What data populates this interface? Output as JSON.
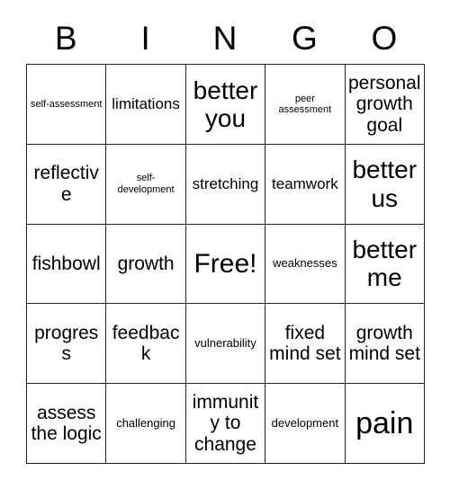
{
  "card": {
    "header_letters": [
      "B",
      "I",
      "N",
      "G",
      "O"
    ],
    "grid_rows": [
      [
        {
          "text": "self-assessment",
          "size": "sz-xs"
        },
        {
          "text": "limitations",
          "size": "sz-m"
        },
        {
          "text": "better you",
          "size": "sz-xl"
        },
        {
          "text": "peer assessment",
          "size": "sz-xs"
        },
        {
          "text": "personal growth goal",
          "size": "sz-l"
        }
      ],
      [
        {
          "text": "reflective",
          "size": "sz-l"
        },
        {
          "text": "self-development",
          "size": "sz-xs"
        },
        {
          "text": "stretching",
          "size": "sz-m"
        },
        {
          "text": "teamwork",
          "size": "sz-m"
        },
        {
          "text": "better us",
          "size": "sz-xl"
        }
      ],
      [
        {
          "text": "fishbowl",
          "size": "sz-l"
        },
        {
          "text": "growth",
          "size": "sz-l"
        },
        {
          "text": "Free!",
          "size": "sz-xxl"
        },
        {
          "text": "weaknesses",
          "size": "sz-s"
        },
        {
          "text": "better me",
          "size": "sz-xl"
        }
      ],
      [
        {
          "text": "progress",
          "size": "sz-l"
        },
        {
          "text": "feedback",
          "size": "sz-l"
        },
        {
          "text": "vulnerability",
          "size": "sz-s"
        },
        {
          "text": "fixed mind set",
          "size": "sz-l"
        },
        {
          "text": "growth mind set",
          "size": "sz-l"
        }
      ],
      [
        {
          "text": "assess the logic",
          "size": "sz-l"
        },
        {
          "text": "challenging",
          "size": "sz-s"
        },
        {
          "text": "immunity to change",
          "size": "sz-l"
        },
        {
          "text": "development",
          "size": "sz-s"
        },
        {
          "text": "pain",
          "size": "sz-huge"
        }
      ]
    ],
    "colors": {
      "background": "#ffffff",
      "text": "#000000",
      "border": "#222222"
    }
  }
}
